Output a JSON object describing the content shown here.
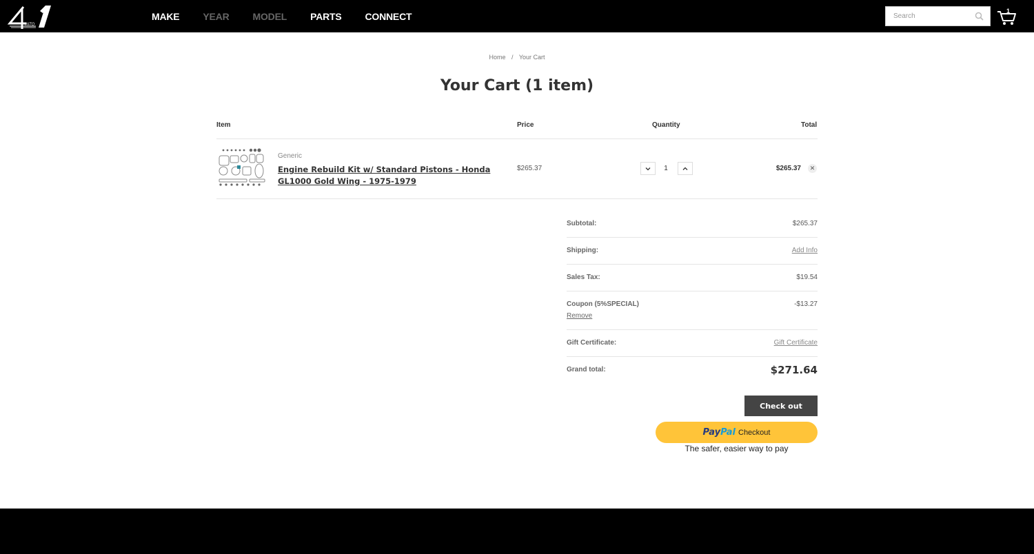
{
  "header": {
    "logo_text": "4 INTO 1",
    "nav": [
      {
        "label": "MAKE",
        "state": "active"
      },
      {
        "label": "YEAR",
        "state": "disabled"
      },
      {
        "label": "MODEL",
        "state": "disabled"
      },
      {
        "label": "PARTS",
        "state": "active"
      },
      {
        "label": "CONNECT",
        "state": "active"
      }
    ],
    "search_placeholder": "Search",
    "cart_count": "1"
  },
  "breadcrumb": {
    "home": "Home",
    "separator": "/",
    "current": "Your Cart"
  },
  "page_title": "Your Cart (1 item)",
  "table": {
    "headers": {
      "item": "Item",
      "price": "Price",
      "quantity": "Quantity",
      "total": "Total"
    },
    "items": [
      {
        "brand": "Generic",
        "name": "Engine Rebuild Kit w/ Standard Pistons - Honda GL1000 Gold Wing - 1975-1979",
        "price": "$265.37",
        "quantity": "1",
        "total": "$265.37"
      }
    ]
  },
  "totals": {
    "subtotal_label": "Subtotal:",
    "subtotal_value": "$265.37",
    "shipping_label": "Shipping:",
    "shipping_value": "Add Info",
    "tax_label": "Sales Tax:",
    "tax_value": "$19.54",
    "coupon_label": "Coupon (5%SPECIAL)",
    "coupon_value": "-$13.27",
    "coupon_remove": "Remove",
    "gift_label": "Gift Certificate:",
    "gift_value": "Gift Certificate",
    "grand_label": "Grand total:",
    "grand_value": "$271.64"
  },
  "actions": {
    "checkout_label": "Check out",
    "paypal_pay": "Pay",
    "paypal_pal": "Pal",
    "paypal_checkout": "Checkout",
    "paypal_tagline": "The safer, easier way to pay"
  },
  "colors": {
    "header_bg": "#000000",
    "checkout_bg": "#444444",
    "paypal_yellow": "#ffc439",
    "paypal_dark_blue": "#253b80",
    "paypal_light_blue": "#179bd7"
  }
}
